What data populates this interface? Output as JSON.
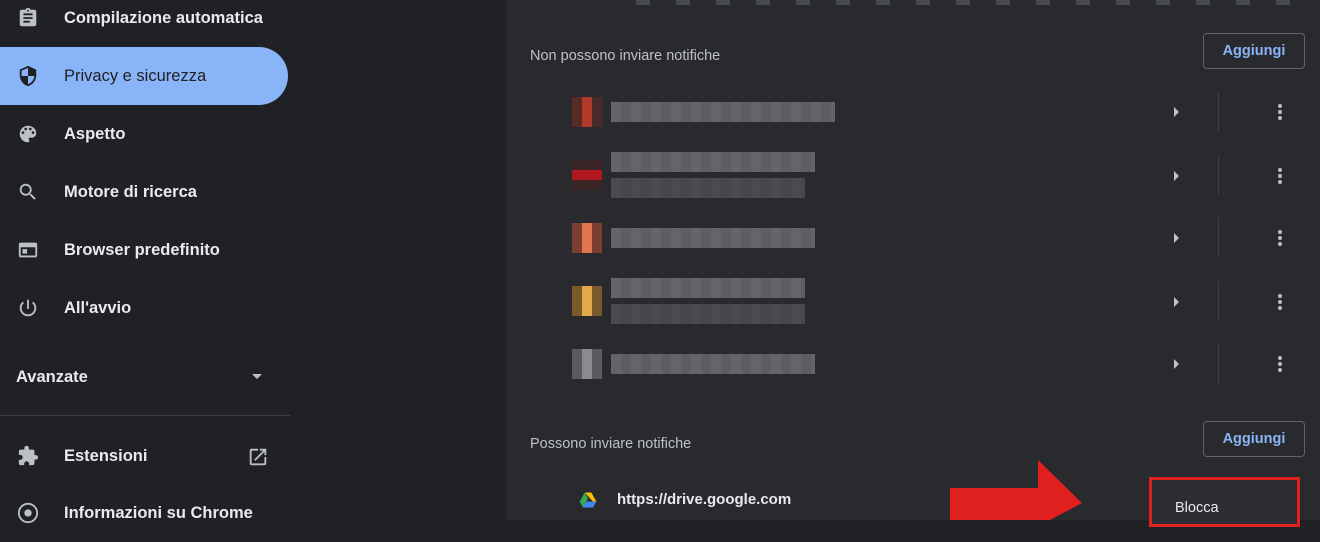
{
  "sidebar": {
    "items": [
      {
        "label": "Compilazione automatica",
        "icon": "clipboard-icon"
      },
      {
        "label": "Privacy e sicurezza",
        "icon": "shield-icon",
        "active": true
      },
      {
        "label": "Aspetto",
        "icon": "palette-icon"
      },
      {
        "label": "Motore di ricerca",
        "icon": "search-icon"
      },
      {
        "label": "Browser predefinito",
        "icon": "browser-icon"
      },
      {
        "label": "All'avvio",
        "icon": "power-icon"
      }
    ],
    "advanced_label": "Avanzate",
    "extensions_label": "Estensioni",
    "about_label": "Informazioni su Chrome"
  },
  "content": {
    "blocked_section": {
      "title": "Non possono inviare notifiche",
      "add_label": "Aggiungi"
    },
    "allowed_section": {
      "title": "Possono inviare notifiche",
      "add_label": "Aggiungi",
      "site_url": "https://drive.google.com"
    },
    "menu_action": "Blocca"
  },
  "colors": {
    "accent": "#8ab4f8",
    "background": "#202124",
    "panel": "#292a2d",
    "highlight_red": "#e01f1f"
  }
}
